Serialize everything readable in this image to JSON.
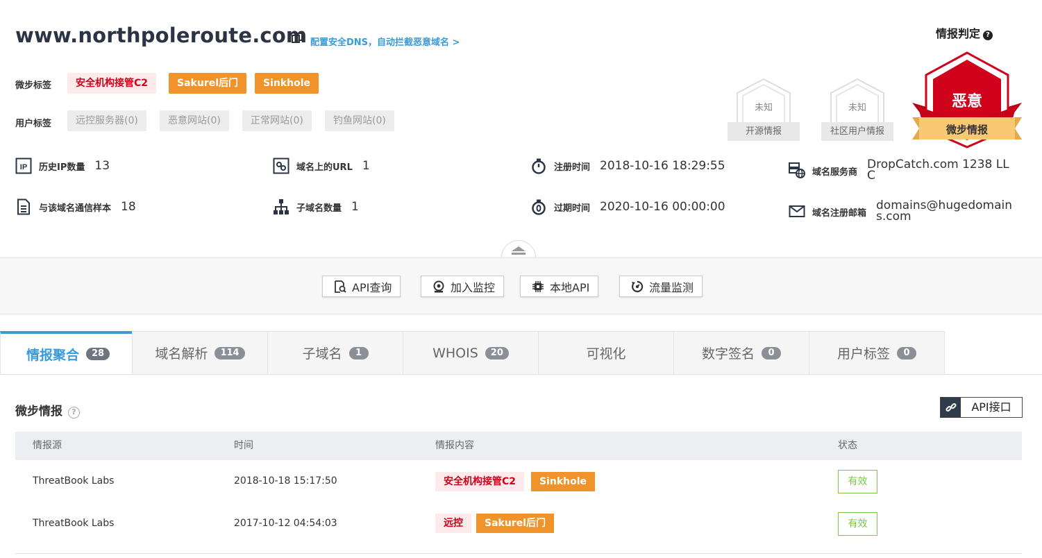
{
  "header": {
    "domain": "www.northpoleroute.com",
    "dns_link": "配置安全DNS，自动拦截恶意域名 >",
    "threatbook_tags_label": "微步标签",
    "threatbook_tags": [
      "安全机构接管C2",
      "Sakurel后门",
      "Sinkhole"
    ],
    "user_tags_label": "用户标签",
    "user_tags": [
      "远控服务器(0)",
      "恶意网站(0)",
      "正常网站(0)",
      "钓鱼网站(0)"
    ]
  },
  "stats": {
    "history_ip": {
      "label": "历史IP数量",
      "value": "13"
    },
    "domain_url": {
      "label": "域名上的URL",
      "value": "1"
    },
    "reg_time": {
      "label": "注册时间",
      "value": "2018-10-16 18:29:55"
    },
    "registrar": {
      "label": "域名服务商",
      "value": "DropCatch.com 1238 LLC"
    },
    "samples": {
      "label": "与该域名通信样本",
      "value": "18"
    },
    "subdomains": {
      "label": "子域名数量",
      "value": "1"
    },
    "expire_time": {
      "label": "过期时间",
      "value": "2020-10-16 00:00:00"
    },
    "reg_email": {
      "label": "域名注册邮箱",
      "value": "domains@hugedomains.com"
    }
  },
  "verdict": {
    "title": "情报判定",
    "open_source": {
      "status": "未知",
      "label": "开源情报"
    },
    "community": {
      "status": "未知",
      "label": "社区用户情报"
    },
    "threatbook": {
      "status": "恶意",
      "label": "微步情报"
    },
    "colors": {
      "malicious": "#d0021b",
      "ribbon": "#f5c26b"
    }
  },
  "actions": [
    "API查询",
    "加入监控",
    "本地API",
    "流量监测"
  ],
  "tabs": [
    {
      "label": "情报聚合",
      "count": "28"
    },
    {
      "label": "域名解析",
      "count": "114"
    },
    {
      "label": "子域名",
      "count": "1"
    },
    {
      "label": "WHOIS",
      "count": "20"
    },
    {
      "label": "可视化",
      "count": ""
    },
    {
      "label": "数字签名",
      "count": "0"
    },
    {
      "label": "用户标签",
      "count": "0"
    }
  ],
  "intel": {
    "title": "微步情报",
    "api_button": "API接口",
    "columns": [
      "情报源",
      "时间",
      "情报内容",
      "状态"
    ],
    "rows": [
      {
        "source": "ThreatBook Labs",
        "time": "2018-10-18 15:17:50",
        "tags": [
          "安全机构接管C2",
          "Sinkhole"
        ],
        "status": "有效"
      },
      {
        "source": "ThreatBook Labs",
        "time": "2017-10-12 04:54:03",
        "tags": [
          "远控",
          "Sakurel后门"
        ],
        "status": "有效"
      }
    ]
  }
}
